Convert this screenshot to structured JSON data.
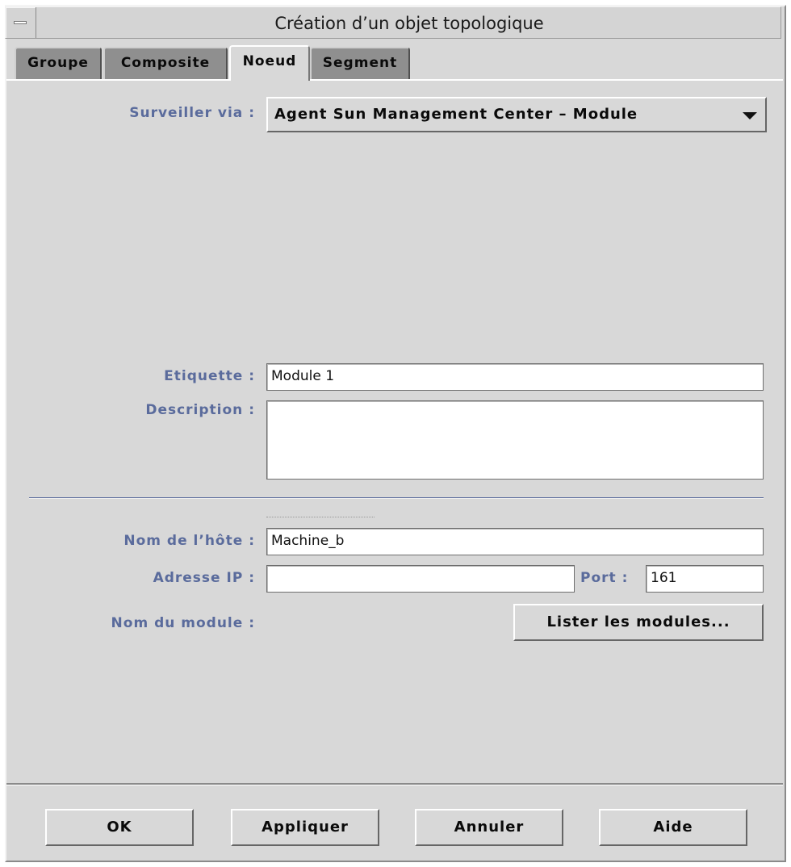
{
  "window": {
    "title": "Création d’un objet topologique"
  },
  "tabs": [
    {
      "label": "Groupe",
      "active": false
    },
    {
      "label": "Composite",
      "active": false
    },
    {
      "label": "Noeud",
      "active": true
    },
    {
      "label": "Segment",
      "active": false
    }
  ],
  "form": {
    "monitor_via": {
      "label": "Surveiller via :",
      "value": "Agent Sun Management Center – Module"
    },
    "label_field": {
      "label": "Etiquette :",
      "value": "Module 1"
    },
    "description": {
      "label": "Description :",
      "value": ""
    },
    "hostname": {
      "label": "Nom de l’hôte :",
      "value": "Machine_b"
    },
    "ip_address": {
      "label": "Adresse IP :",
      "value": ""
    },
    "port": {
      "label": "Port :",
      "value": "161"
    },
    "module_name": {
      "label": "Nom du module :"
    },
    "list_modules_button": "Lister les modules..."
  },
  "buttons": {
    "ok": "OK",
    "apply": "Appliquer",
    "cancel": "Annuler",
    "help": "Aide"
  },
  "colors": {
    "label_text": "#5a6b9c",
    "dialog_bg": "#d8d8d8",
    "inactive_tab": "#8f8f8f"
  }
}
